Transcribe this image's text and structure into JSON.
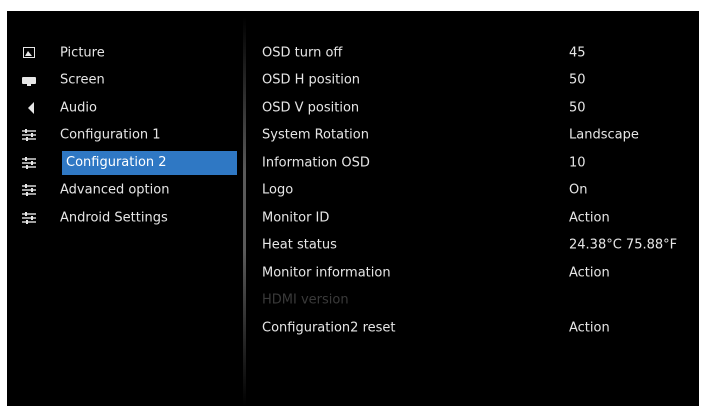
{
  "sidebar": {
    "items": [
      {
        "label": "Picture",
        "icon": "picture-icon"
      },
      {
        "label": "Screen",
        "icon": "screen-icon"
      },
      {
        "label": "Audio",
        "icon": "speaker-icon"
      },
      {
        "label": "Configuration 1",
        "icon": "sliders-icon"
      },
      {
        "label": "Configuration 2",
        "icon": "sliders-icon",
        "selected": true
      },
      {
        "label": "Advanced option",
        "icon": "sliders-icon"
      },
      {
        "label": "Android Settings",
        "icon": "sliders-icon"
      }
    ]
  },
  "settings": {
    "rows": [
      {
        "name": "OSD turn off",
        "value": "45"
      },
      {
        "name": "OSD H position",
        "value": "50"
      },
      {
        "name": "OSD V position",
        "value": "50"
      },
      {
        "name": "System Rotation",
        "value": "Landscape"
      },
      {
        "name": "Information OSD",
        "value": "10"
      },
      {
        "name": "Logo",
        "value": "On"
      },
      {
        "name": "Monitor ID",
        "value": "Action"
      },
      {
        "name": "Heat status",
        "value": "24.38°C 75.88°F"
      },
      {
        "name": "Monitor information",
        "value": "Action"
      },
      {
        "name": "HDMI version",
        "value": "",
        "disabled": true
      },
      {
        "name": "Configuration2 reset",
        "value": "Action"
      }
    ]
  },
  "colors": {
    "background": "#000000",
    "text": "#e6e6e6",
    "selected": "#2f78c4",
    "disabled_text": "#3a3a3a"
  }
}
